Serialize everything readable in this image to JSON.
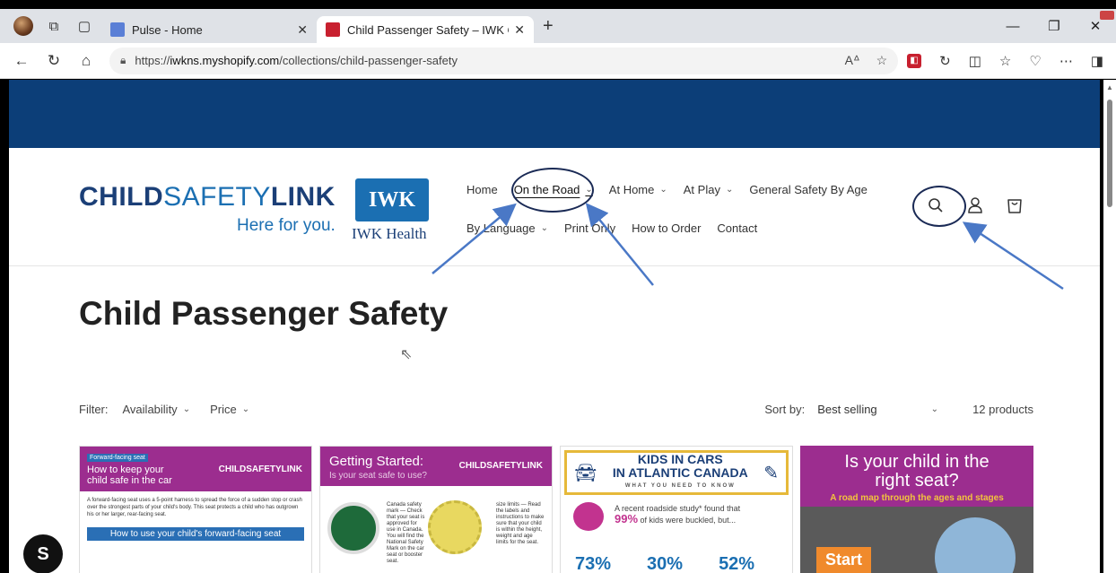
{
  "browser": {
    "tabs": [
      {
        "title": "Pulse - Home",
        "favicon_color": "#5a7fd6"
      },
      {
        "title": "Child Passenger Safety – IWK Chil",
        "favicon_color": "#c8202f"
      }
    ],
    "url_scheme": "https://",
    "url_host": "iwkns.myshopify.com",
    "url_path": "/collections/child-passenger-safety",
    "new_tab": "+"
  },
  "site": {
    "logo_main_bold": "CHILD",
    "logo_main_light": "SAFETY",
    "logo_main_end": "LINK",
    "logo_tagline": "Here for you.",
    "iwk_mark": "IWK",
    "iwk_name": "IWK Health",
    "menu_row1": [
      {
        "label": "Home",
        "has_dropdown": false,
        "active": false
      },
      {
        "label": "On the Road",
        "has_dropdown": true,
        "active": true
      },
      {
        "label": "At Home",
        "has_dropdown": true,
        "active": false
      },
      {
        "label": "At Play",
        "has_dropdown": true,
        "active": false
      },
      {
        "label": "General Safety By Age",
        "has_dropdown": false,
        "active": false
      }
    ],
    "menu_row2": [
      {
        "label": "By Language",
        "has_dropdown": true
      },
      {
        "label": "Print Only",
        "has_dropdown": false
      },
      {
        "label": "How to Order",
        "has_dropdown": false
      },
      {
        "label": "Contact",
        "has_dropdown": false
      }
    ]
  },
  "collection": {
    "title": "Child Passenger Safety",
    "filter_label": "Filter:",
    "filter_availability": "Availability",
    "filter_price": "Price",
    "sort_label": "Sort by:",
    "sort_value": "Best selling",
    "product_count": "12 products"
  },
  "products": [
    {
      "tag": "Forward-facing seat",
      "title": "How to keep your child safe in the car",
      "logo": "CHILDSAFETYLINK",
      "body": "A forward-facing seat uses a 5-point harness to spread the force of a sudden stop or crash over the strongest parts of your child's body. This seat protects a child who has outgrown his or her larger, rear-facing seat.",
      "band": "How to use your child's forward-facing seat"
    },
    {
      "title": "Getting Started:",
      "subtitle": "Is your seat safe to use?",
      "logo": "CHILDSAFETYLINK",
      "text1": "Canada safety mark — Check that your seat is approved for use in Canada. You will find the National Safety Mark on the car seat or booster seat.",
      "text2": "size limits — Read the labels and instructions to make sure that your child is within the height, weight and age limits for the seat."
    },
    {
      "title_line1": "KIDS IN CARS",
      "title_line2": "IN ATLANTIC CANADA",
      "subtitle": "WHAT YOU NEED TO KNOW",
      "stat_text_pre": "A recent roadside study* found that",
      "stat_value": "99%",
      "stat_text_post": "of kids were buckled, but...",
      "percents": [
        "73%",
        "30%",
        "52%"
      ]
    },
    {
      "title": "Is your child in the right seat?",
      "subtitle": "A road map through the ages and stages",
      "cta": "Start"
    }
  ],
  "icons": {
    "search": "⌕",
    "account": "♙",
    "cart": "▢"
  },
  "colors": {
    "banner": "#0c3e78",
    "brand_blue": "#1b6fb2",
    "brand_purple": "#9c2d8f",
    "annotation": "#4a78c6"
  }
}
